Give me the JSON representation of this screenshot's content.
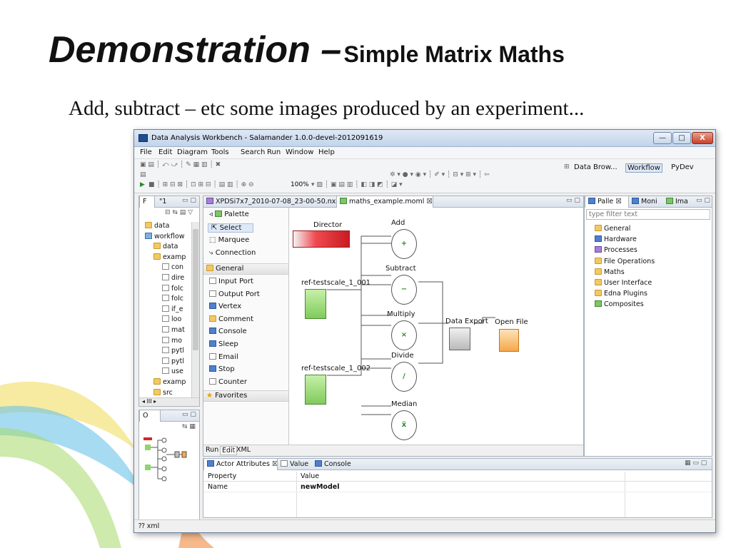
{
  "slide": {
    "title_main": "Demonstration –",
    "title_sub": "Simple Matrix Maths",
    "subtitle": "Add, subtract – etc some images produced by an experiment..."
  },
  "window": {
    "title": "Data Analysis Workbench  -  Salamander    1.0.0-devel-2012091619",
    "buttons": [
      "—",
      "□",
      "X"
    ]
  },
  "menu": [
    "File",
    "Edit",
    "Diagram",
    "Tools",
    "Search",
    "Run",
    "Window",
    "Help"
  ],
  "toolbar": {
    "zoom": "100%"
  },
  "perspectives": [
    "Data Brow...",
    "Workflow",
    "PyDev"
  ],
  "project_tree": {
    "tabs": [
      "F",
      "\"1"
    ],
    "items": [
      {
        "label": "data",
        "icon": "folder",
        "indent": 0
      },
      {
        "label": "workflow",
        "icon": "proj",
        "indent": 0
      },
      {
        "label": "data",
        "icon": "folder",
        "indent": 1
      },
      {
        "label": "examp",
        "icon": "folder",
        "indent": 1
      },
      {
        "label": "con",
        "icon": "file",
        "indent": 2
      },
      {
        "label": "dire",
        "icon": "file",
        "indent": 2
      },
      {
        "label": "folc",
        "icon": "file",
        "indent": 2
      },
      {
        "label": "folc",
        "icon": "file",
        "indent": 2
      },
      {
        "label": "if_e",
        "icon": "file",
        "indent": 2
      },
      {
        "label": "loo",
        "icon": "file",
        "indent": 2
      },
      {
        "label": "mat",
        "icon": "file",
        "indent": 2
      },
      {
        "label": "mo",
        "icon": "file",
        "indent": 2
      },
      {
        "label": "pytl",
        "icon": "file",
        "indent": 2
      },
      {
        "label": "pytl",
        "icon": "file",
        "indent": 2
      },
      {
        "label": "use",
        "icon": "file",
        "indent": 2
      },
      {
        "label": "examp",
        "icon": "folder",
        "indent": 1
      },
      {
        "label": "src",
        "icon": "folder",
        "indent": 1
      }
    ],
    "scroll_label": "III"
  },
  "outline": {
    "tab": "O"
  },
  "editor_tabs": [
    {
      "label": "XPDSi7x7_2010-07-08_23-00-50.nxs",
      "active": false
    },
    {
      "label": "maths_example.moml",
      "active": true
    }
  ],
  "palette": {
    "header": "Palette",
    "tools": [
      "Select",
      "Marquee",
      "Connection"
    ],
    "general_label": "General",
    "general_items": [
      "Input Port",
      "Output Port",
      "Vertex",
      "Comment",
      "Console",
      "Sleep",
      "Email",
      "Stop",
      "Counter"
    ],
    "favorites_label": "Favorites"
  },
  "diagram": {
    "director": "Director",
    "sources": [
      "ref-testscale_1_001",
      "ref-testscale_1_002"
    ],
    "operations": [
      {
        "label": "Add",
        "symbol": "+"
      },
      {
        "label": "Subtract",
        "symbol": "−"
      },
      {
        "label": "Multiply",
        "symbol": "×"
      },
      {
        "label": "Divide",
        "symbol": "/"
      },
      {
        "label": "Median",
        "symbol": "x̃"
      }
    ],
    "export_label": "Data Export",
    "open_label": "Open File"
  },
  "editor_bottom_tabs": [
    "Run",
    "Edit",
    "XML"
  ],
  "right_panel": {
    "tabs": [
      "Palle",
      "Moni",
      "Ima"
    ],
    "filter_placeholder": "type filter text",
    "items": [
      {
        "label": "General",
        "icon": "folder"
      },
      {
        "label": "Hardware",
        "icon": "blue"
      },
      {
        "label": "Processes",
        "icon": "purple"
      },
      {
        "label": "File Operations",
        "icon": "folder"
      },
      {
        "label": "Maths",
        "icon": "folder"
      },
      {
        "label": "User Interface",
        "icon": "folder"
      },
      {
        "label": "Edna Plugins",
        "icon": "folder"
      },
      {
        "label": "Composites",
        "icon": "green"
      }
    ]
  },
  "attributes": {
    "tabs": [
      "Actor Attributes",
      "Value",
      "Console"
    ],
    "columns": [
      "Property",
      "Value"
    ],
    "rows": [
      {
        "property": "Name",
        "value": "newModel"
      }
    ]
  },
  "status": {
    "text": "xml"
  },
  "colors": {
    "director": "#d9242b",
    "source": "#8fd66a",
    "export": "#bdbdbd",
    "open": "#f5a84a",
    "accent": "#3d6fb5"
  }
}
